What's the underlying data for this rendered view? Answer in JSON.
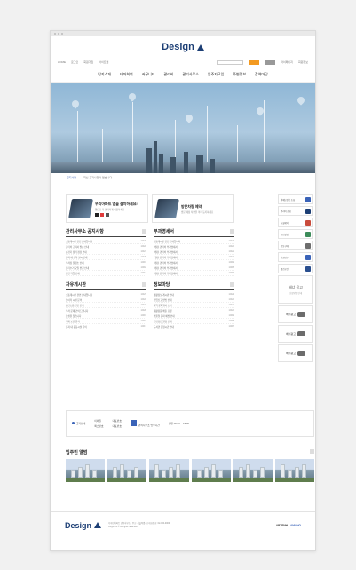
{
  "header": {
    "logo_text": "Design",
    "util_left": [
      "HOME",
      "로그인",
      "회원가입",
      "사이트맵"
    ],
    "util_right": [
      "마이페이지",
      "회원정보",
      "관리자"
    ],
    "search_placeholder": "검색어 입력"
  },
  "gnb": {
    "items": [
      "단지소개",
      "테마회의",
      "커뮤니티",
      "관리비",
      "관리사무소",
      "입주자모임",
      "주변정보",
      "참여마당"
    ]
  },
  "notice_bar": {
    "label": "공지사항",
    "text": "최신 공지사항이 없습니다"
  },
  "promo": [
    {
      "title": "우리아파트 앱을 설치하세요!",
      "sub": "앱으로 더 편리하게 이용하세요"
    },
    {
      "title": "방문차량 예약",
      "sub": "방문 예정 차량을 미리 등록하세요"
    }
  ],
  "boards": [
    {
      "title": "관리사무소 공지사항",
      "rows": [
        {
          "t": "소통게시판 관련 안내입니다",
          "d": "10/23"
        },
        {
          "t": "관리비 고지서 발송 안내",
          "d": "10/22"
        },
        {
          "t": "승강기 정기 점검 안내",
          "d": "10/21"
        },
        {
          "t": "단지 내 소독 실시 안내",
          "d": "10/20"
        },
        {
          "t": "주차장 물청소 안내",
          "d": "10/19"
        },
        {
          "t": "분리수거 요일 변경 안내",
          "d": "10/18"
        },
        {
          "t": "정전 작업 안내",
          "d": "10/17"
        }
      ]
    },
    {
      "title": "부과명세서",
      "rows": [
        {
          "t": "소통게시판 관련 안내입니다",
          "d": "10/23"
        },
        {
          "t": "9월분 관리비 부과명세서",
          "d": "10/22"
        },
        {
          "t": "8월분 관리비 부과명세서",
          "d": "10/21"
        },
        {
          "t": "7월분 관리비 부과명세서",
          "d": "10/20"
        },
        {
          "t": "6월분 관리비 부과명세서",
          "d": "10/19"
        },
        {
          "t": "5월분 관리비 부과명세서",
          "d": "10/18"
        },
        {
          "t": "4월분 관리비 부과명세서",
          "d": "10/17"
        }
      ]
    },
    {
      "title": "자유게시판",
      "rows": [
        {
          "t": "소통게시판 관련 안내입니다",
          "d": "10/23"
        },
        {
          "t": "놀이터 시설 문의",
          "d": "10/22"
        },
        {
          "t": "층간소음 관련 건의",
          "d": "10/21"
        },
        {
          "t": "주차 문제 건의드립니다",
          "d": "10/20"
        },
        {
          "t": "분실물 찾습니다",
          "d": "10/19"
        },
        {
          "t": "택배 보관 문의",
          "d": "10/18"
        },
        {
          "t": "단지 내 운동시설 문의",
          "d": "10/17"
        }
      ]
    },
    {
      "title": "정보마당",
      "rows": [
        {
          "t": "생활정보 게시판 안내",
          "d": "10/23"
        },
        {
          "t": "전입신고 방법 안내",
          "d": "10/22"
        },
        {
          "t": "지역 문화행사 소식",
          "d": "10/21"
        },
        {
          "t": "재활용품 배출 요령",
          "d": "10/20"
        },
        {
          "t": "겨울철 동파 예방 안내",
          "d": "10/19"
        },
        {
          "t": "건강검진 일정 안내",
          "d": "10/18"
        },
        {
          "t": "도서관 운영시간 안내",
          "d": "10/17"
        }
      ]
    }
  ],
  "side": {
    "items": [
      {
        "label": "택배보관함 조회",
        "color": "#3a63b8"
      },
      {
        "label": "관리비 조회",
        "color": "#1d3f75"
      },
      {
        "label": "시설예약",
        "color": "#c94b3b"
      },
      {
        "label": "주민일정",
        "color": "#3c8c5a"
      },
      {
        "label": "공동구매",
        "color": "#6d6d6d"
      },
      {
        "label": "민원접수",
        "color": "#3a63b8"
      },
      {
        "label": "열린공간",
        "color": "#2a4f8f"
      }
    ],
    "big_banner": {
      "title": "배너 공고",
      "sub": "신청방법 안내"
    },
    "small_banners": [
      "배너광고",
      "배너광고",
      "배너광고"
    ]
  },
  "infobar": {
    "left_label": "공지안내",
    "cols": [
      "이메일",
      "대표번호",
      "팩스번호",
      "대표번호"
    ],
    "schedule_label": "관리사무소 업무시간",
    "schedule_text": "평일 09:00 ~ 18:00"
  },
  "gallery": {
    "title": "입주민 앨범"
  },
  "footer": {
    "logo_text": "Design",
    "line1": "디자인아파트 관리사무소 | 주소: 서울특별시 | 대표번호: 02-000-0000",
    "line2": "Copyright © All rights reserved.",
    "partners": [
      "APTENH",
      "AMANO"
    ]
  }
}
